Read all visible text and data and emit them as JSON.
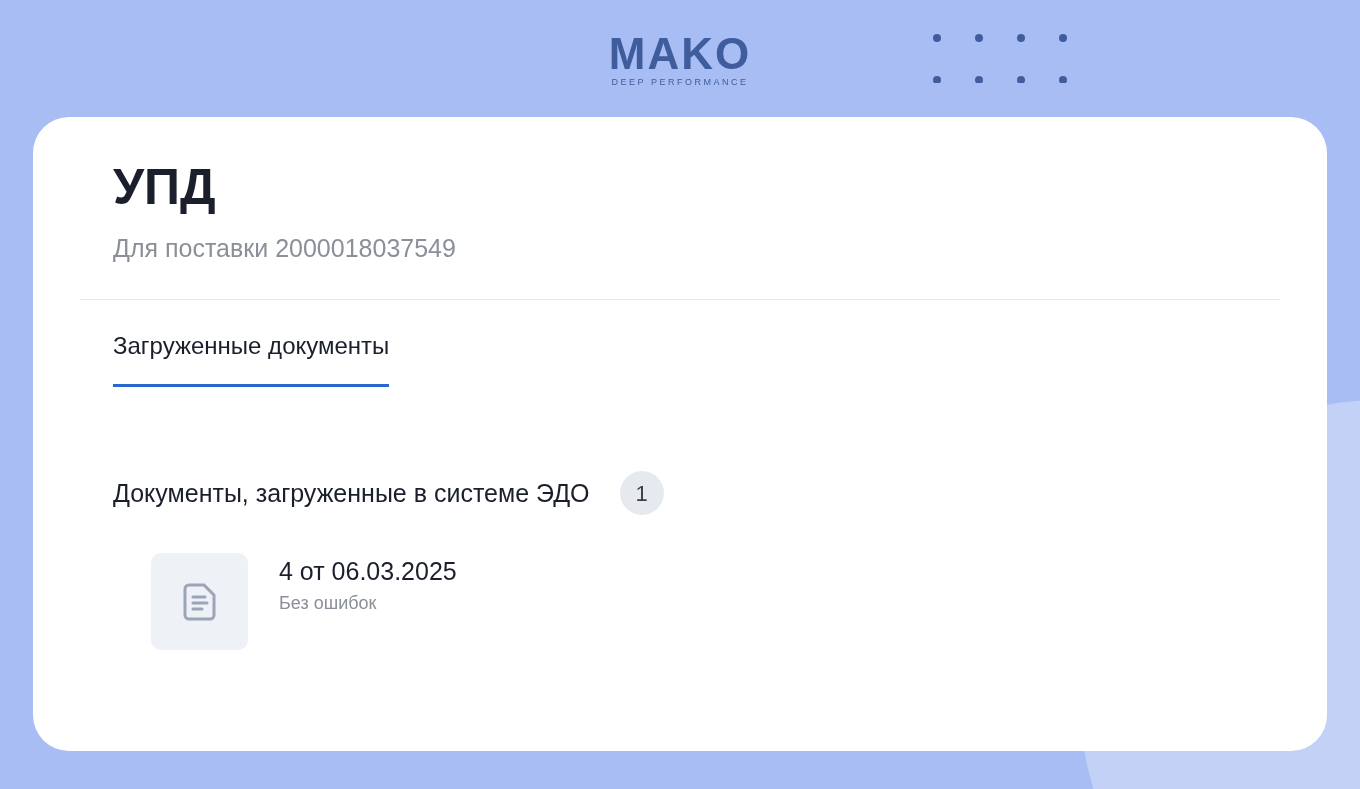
{
  "logo": {
    "name": "MAKO",
    "tagline": "DEEP PERFORMANCE"
  },
  "card": {
    "title": "УПД",
    "subtitle": "Для поставки 2000018037549",
    "tabs": [
      {
        "label": "Загруженные документы",
        "selected": true
      }
    ],
    "section": {
      "title": "Документы, загруженные в системе ЭДО",
      "count": "1"
    },
    "documents": [
      {
        "name": "4 от 06.03.2025",
        "status": "Без ошибок"
      }
    ]
  }
}
